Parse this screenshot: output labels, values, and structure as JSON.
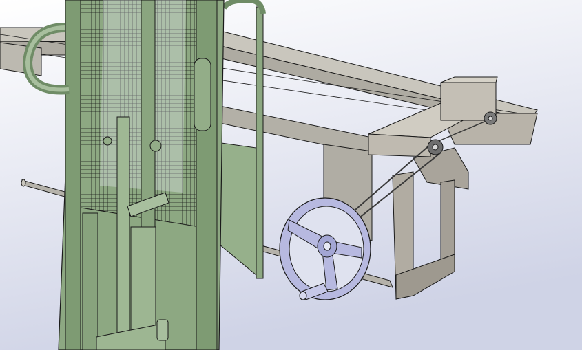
{
  "viewport": {
    "background_top": "#ffffff",
    "background_bottom": "#cfd3e6"
  },
  "colors": {
    "frame_green": "#8da882",
    "frame_green_dark": "#6f8c66",
    "frame_green_light": "#a8bf9e",
    "rail_gray": "#b8b6ae",
    "rail_gray_dark": "#9b988f",
    "carriage_gray": "#c2bdb3",
    "bracket_gray": "#aaa59c",
    "handwheel": "#b7b9e0",
    "handwheel_dark": "#8e92c8",
    "outline": "#1a1a1a",
    "cable": "#3a3a3a"
  },
  "model": {
    "parts": [
      {
        "name": "green-lift-frame"
      },
      {
        "name": "wire-mesh-guard"
      },
      {
        "name": "overhead-rail"
      },
      {
        "name": "trolley-carriage"
      },
      {
        "name": "support-bracket"
      },
      {
        "name": "cross-shaft"
      },
      {
        "name": "handwheel"
      },
      {
        "name": "cable-pulley"
      },
      {
        "name": "drive-cables"
      }
    ]
  }
}
